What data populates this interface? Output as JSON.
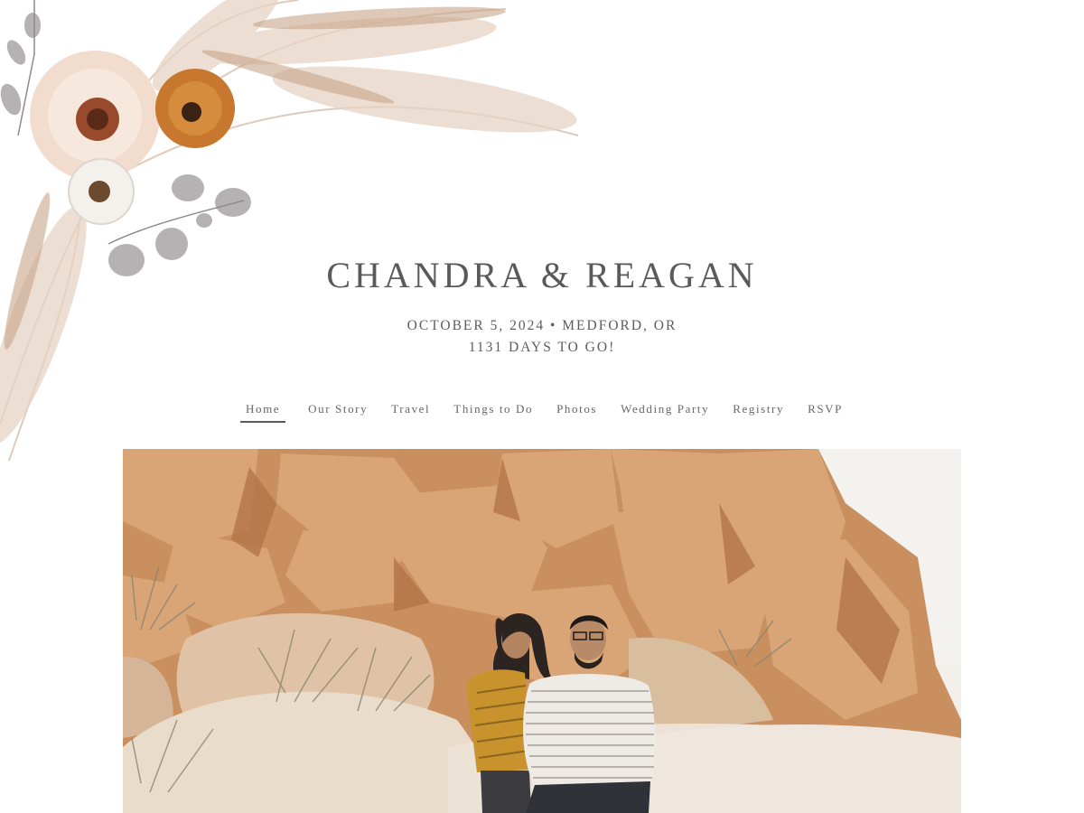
{
  "header": {
    "title": "CHANDRA & REAGAN",
    "date_location": "OCTOBER 5, 2024 • MEDFORD, OR",
    "countdown": "1131 DAYS TO GO!"
  },
  "nav": {
    "active": "Home",
    "items": [
      {
        "label": "Home"
      },
      {
        "label": "Our Story"
      },
      {
        "label": "Travel"
      },
      {
        "label": "Things to Do"
      },
      {
        "label": "Photos"
      },
      {
        "label": "Wedding Party"
      },
      {
        "label": "Registry"
      },
      {
        "label": "RSVP"
      }
    ]
  },
  "hero_photo": {
    "subject": "couple-on-desert-boulders-photo"
  },
  "decoration": {
    "subject": "watercolor-floral-pampas-icon"
  },
  "colors": {
    "text": "#5a5a5a",
    "background": "#ffffff",
    "rock": "#d9a577",
    "rock_shadow": "#b97d4f"
  }
}
